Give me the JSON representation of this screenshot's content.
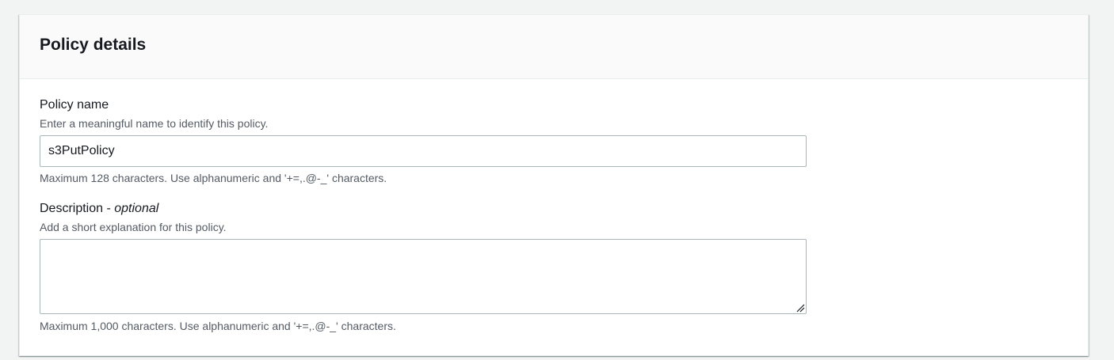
{
  "panel": {
    "title": "Policy details"
  },
  "policy_name": {
    "label": "Policy name",
    "description": "Enter a meaningful name to identify this policy.",
    "value": "s3PutPolicy",
    "constraint": "Maximum 128 characters. Use alphanumeric and '+=,.@-_' characters."
  },
  "description_field": {
    "label": "Description",
    "label_separator": " - ",
    "optional": "optional",
    "description": "Add a short explanation for this policy.",
    "value": "",
    "constraint": "Maximum 1,000 characters. Use alphanumeric and '+=,.@-_' characters."
  },
  "icons": {
    "textarea_resize": "resize-grip-icon"
  }
}
